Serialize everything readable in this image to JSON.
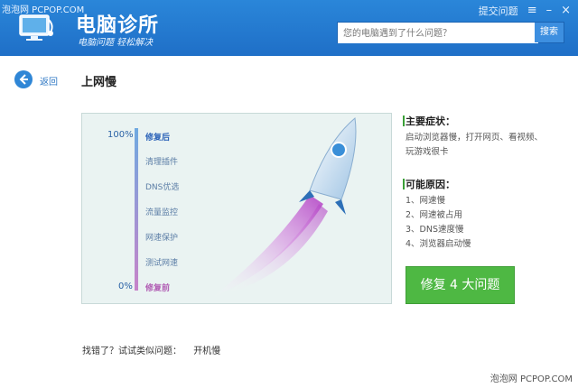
{
  "header": {
    "watermark": "泡泡网 PCPOP.COM",
    "brand": "电脑诊所",
    "slogan": "电脑问题 轻松解决",
    "submit_question": "提交问题",
    "search": {
      "placeholder": "您的电脑遇到了什么问题？",
      "button": "搜索"
    },
    "controls": {
      "menu": "≡",
      "minimize": "–",
      "close": "×"
    }
  },
  "nav": {
    "back": "返回",
    "title": "上网慢"
  },
  "progress": {
    "top_percent": "100%",
    "bottom_percent": "0%",
    "steps": [
      "修复后",
      "清理插件",
      "DNS优选",
      "流量监控",
      "网速保护",
      "测试网速",
      "修复前"
    ]
  },
  "symptoms": {
    "title": "主要症状：",
    "lines": [
      "启动浏览器慢，打开网页、看视频、",
      "玩游戏很卡"
    ]
  },
  "causes": {
    "title": "可能原因：",
    "items": [
      "1、网速慢",
      "2、网速被占用",
      "3、DNS速度慢",
      "4、浏览器启动慢"
    ]
  },
  "fix_button": "修复 4 大问题",
  "footer": {
    "prompt": "找错了？试试类似问题：",
    "related": "开机慢",
    "watermark": "泡泡网 PCPOP.COM"
  },
  "colors": {
    "header": "#2a86d9",
    "fix_button": "#4eb843",
    "panel": "#eaf3f2"
  }
}
